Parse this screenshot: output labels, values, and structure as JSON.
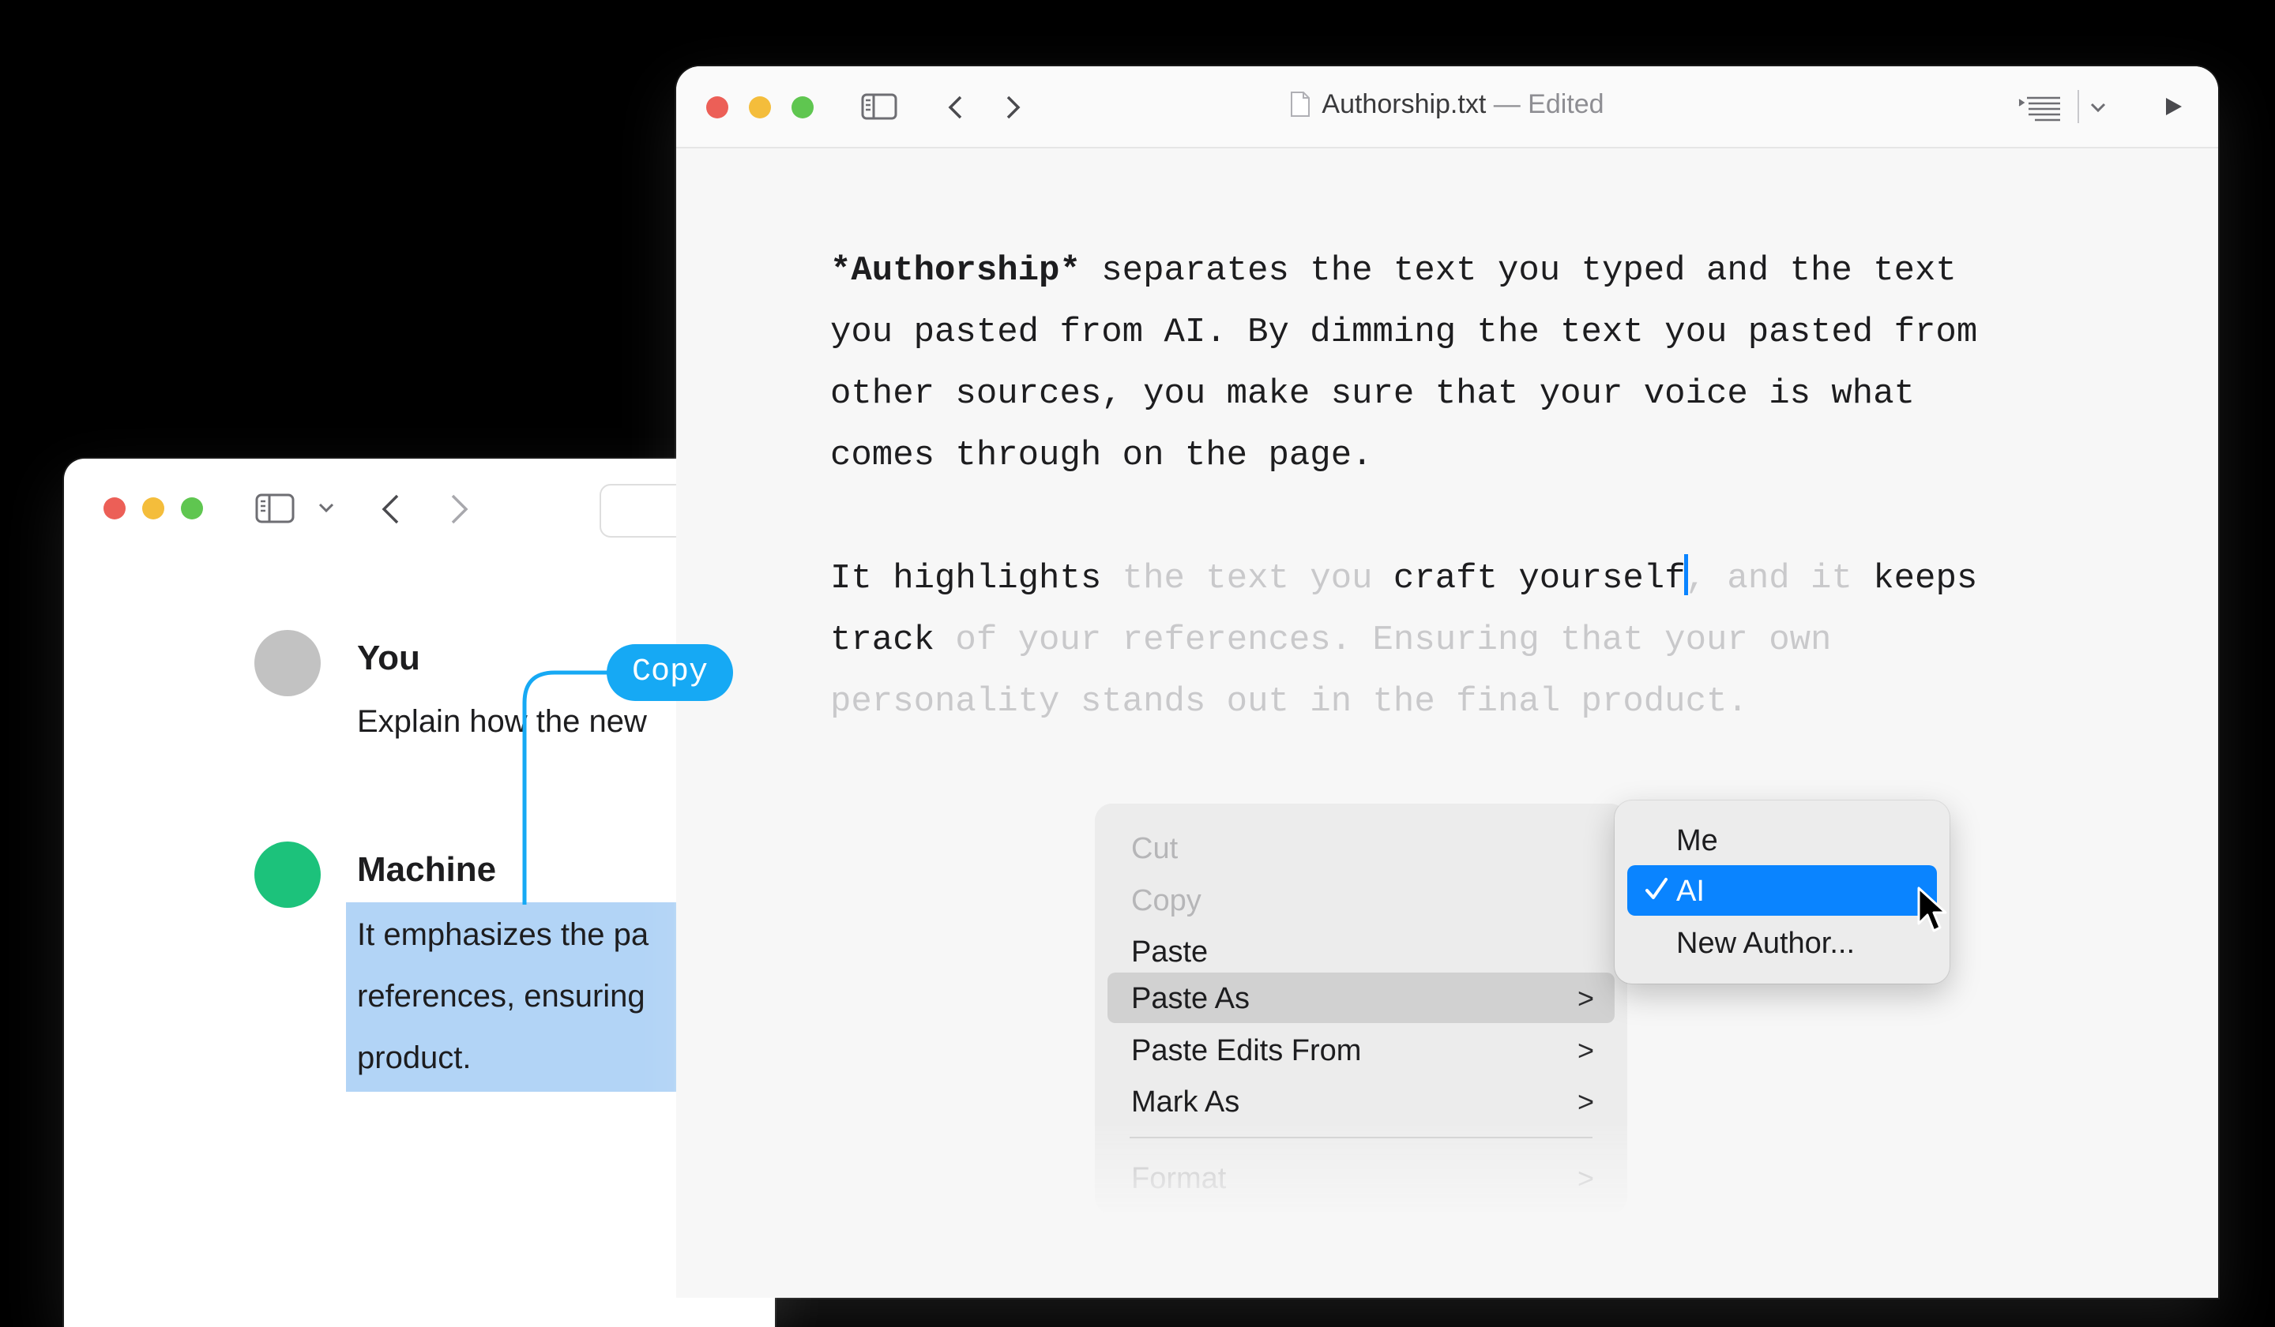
{
  "chat_window": {
    "messages": [
      {
        "author": "You",
        "text": "Explain how the new",
        "avatar_color": "#c2c2c2"
      },
      {
        "author": "Machine",
        "lines": [
          "It emphasizes the pa",
          "references, ensuring",
          "product."
        ],
        "avatar_color": "#1cc27b"
      }
    ],
    "selection_color": "#b2d4f6"
  },
  "annotation": {
    "copy_label": "Copy",
    "accent_color": "#16a9f4"
  },
  "editor_window": {
    "filename": "Authorship.txt",
    "status": "— Edited",
    "paragraph1": [
      "*Authorship* separates the text you typed and the text",
      "you pasted from AI. By dimming the text you pasted from",
      "other sources, you make sure that your voice is what",
      "comes through on the page."
    ],
    "paragraph2": {
      "l1_a": "It highlights ",
      "l1_b": "the text you",
      "l1_c": " craft yourself",
      "l1_d": ", and it",
      "l1_e": " keeps",
      "l2_a": "track",
      "l2_b": " of your references. Ensuring that your own",
      "l3": "personality stands out in the final product."
    }
  },
  "context_menu": {
    "items": [
      {
        "label": "Cut",
        "disabled": true
      },
      {
        "label": "Copy",
        "disabled": true
      },
      {
        "label": "Paste",
        "disabled": false
      },
      {
        "label": "Paste As",
        "submenu": true,
        "active": true
      },
      {
        "label": "Paste Edits From",
        "submenu": true
      },
      {
        "label": "Mark As",
        "submenu": true
      },
      {
        "label": "Format",
        "submenu": true,
        "disabled": true
      }
    ]
  },
  "submenu": {
    "items": [
      {
        "label": "Me"
      },
      {
        "label": "AI",
        "checked": true
      },
      {
        "label": "New Author..."
      }
    ]
  }
}
